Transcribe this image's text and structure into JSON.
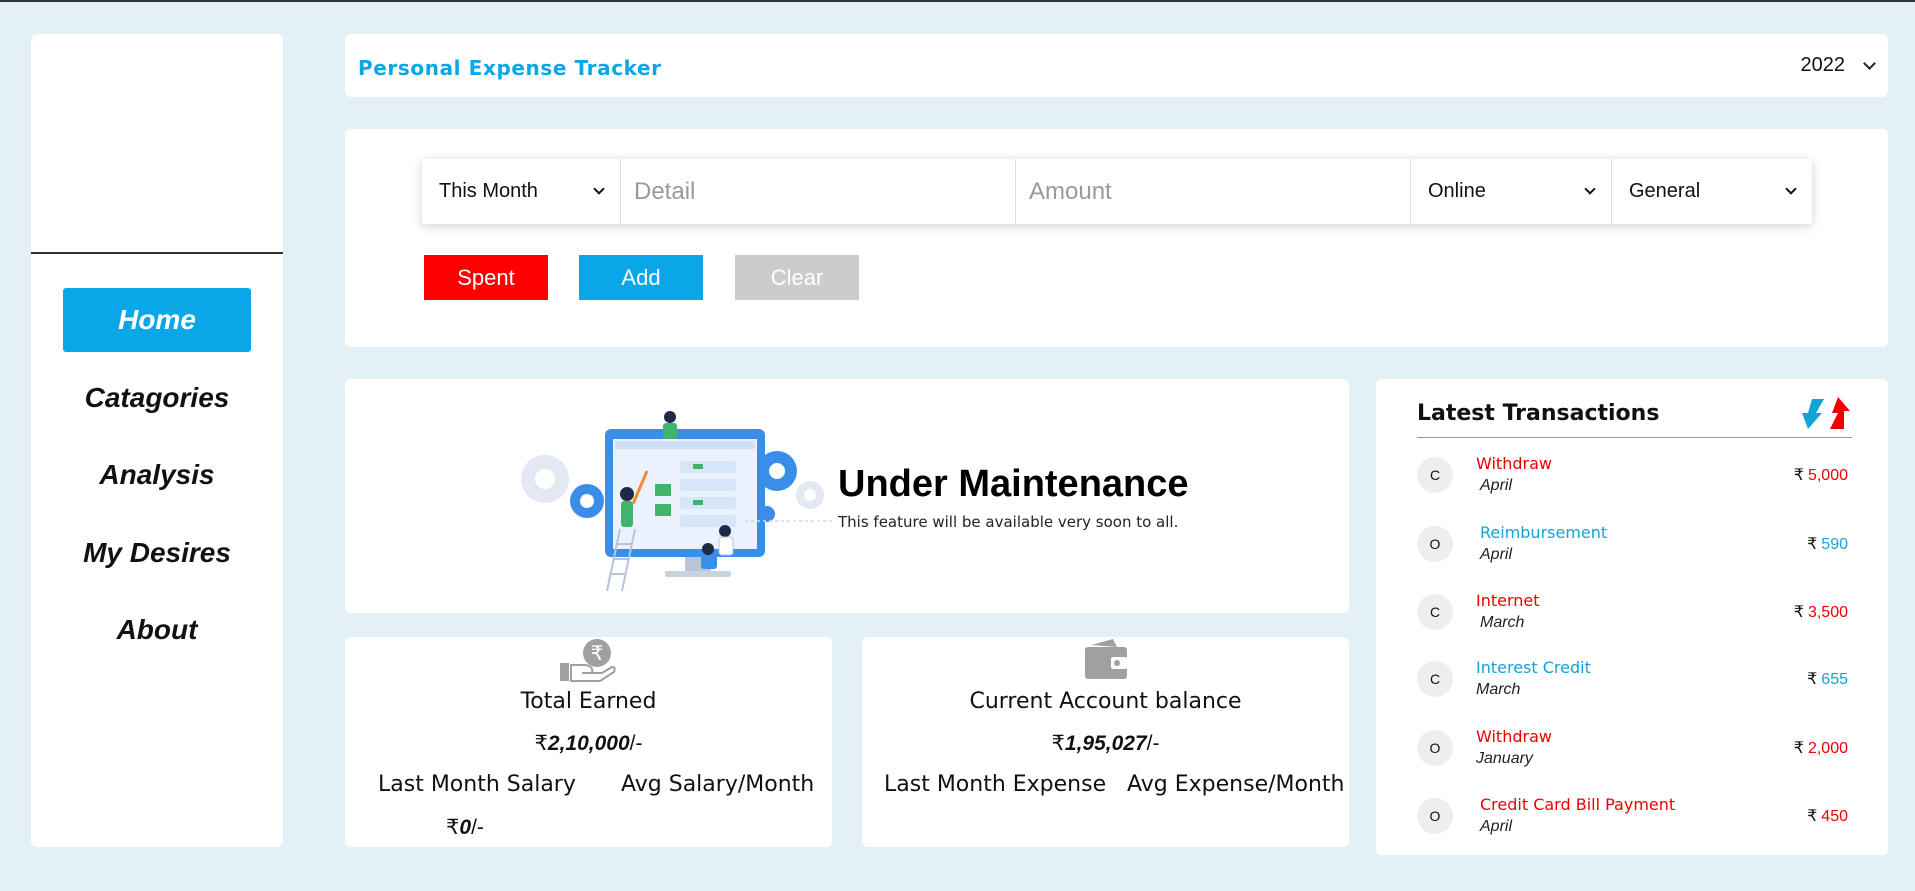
{
  "header": {
    "title": "Personal Expense Tracker",
    "year": "2022"
  },
  "sidebar": {
    "items": [
      {
        "label": "Home",
        "active": true
      },
      {
        "label": "Catagories"
      },
      {
        "label": "Analysis"
      },
      {
        "label": "My Desires"
      },
      {
        "label": "About"
      }
    ]
  },
  "form": {
    "period": "This Month",
    "detail_placeholder": "Detail",
    "amount_placeholder": "Amount",
    "mode": "Online",
    "category": "General",
    "spent_label": "Spent",
    "add_label": "Add",
    "clear_label": "Clear"
  },
  "maintenance": {
    "title": "Under Maintenance",
    "subtitle": "This feature will be available very soon to all."
  },
  "earned": {
    "label": "Total Earned",
    "currency": "₹",
    "value": "2,10,000",
    "suffix": "/-",
    "sub_left": "Last Month Salary",
    "sub_right": "Avg Salary/Month",
    "sub_left_value": "0"
  },
  "balance": {
    "label": "Current Account balance",
    "currency": "₹",
    "value": "1,95,027",
    "suffix": "/-",
    "sub_left": "Last Month Expense",
    "sub_right": "Avg Expense/Month"
  },
  "transactions": {
    "title": "Latest Transactions",
    "items": [
      {
        "badge": "C",
        "name": "Withdraw",
        "month": "April",
        "amount": "5,000",
        "color": "#ee0000"
      },
      {
        "badge": "O",
        "name": "Reimbursement",
        "month": "April",
        "amount": "590",
        "color": "#13a3d6"
      },
      {
        "badge": "C",
        "name": "Internet",
        "month": "March",
        "amount": "3,500",
        "color": "#ee0000"
      },
      {
        "badge": "C",
        "name": "Interest Credit",
        "month": "March",
        "amount": "655",
        "color": "#13a3d6"
      },
      {
        "badge": "O",
        "name": "Withdraw",
        "month": "January",
        "amount": "2,000",
        "color": "#ee0000"
      },
      {
        "badge": "O",
        "name": "Credit Card Bill Payment",
        "month": "April",
        "amount": "450",
        "color": "#ee0000"
      }
    ],
    "currency": "₹"
  },
  "colors": {
    "accent": "#0aa7e8",
    "spent": "#ff0000",
    "clear": "#cccccc",
    "credit": "#13a3d6",
    "debit": "#ee0000"
  }
}
